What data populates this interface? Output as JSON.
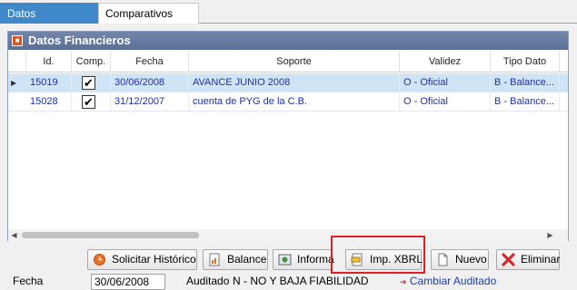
{
  "tabs": [
    {
      "label": "Datos Financieros",
      "active": true
    },
    {
      "label": "Comparativos",
      "active": false
    }
  ],
  "panel": {
    "title": "Datos Financieros",
    "columns": [
      "Id.",
      "Comp.",
      "Fecha",
      "Soporte",
      "Validez",
      "Tipo Dato"
    ],
    "rows": [
      {
        "id": "15019",
        "comp": true,
        "fecha": "30/06/2008",
        "soporte": "AVANCE JUNIO 2008",
        "validez": "O - Oficial",
        "tipo": "B - Balance...",
        "selected": true
      },
      {
        "id": "15028",
        "comp": true,
        "fecha": "31/12/2007",
        "soporte": "cuenta de PYG de la C.B.",
        "validez": "O - Oficial",
        "tipo": "B - Balance...",
        "selected": false
      }
    ]
  },
  "buttons": {
    "solicitar": "Solicitar Histórico",
    "balance": "Balance",
    "informa": "Informa",
    "imp_xbrl": "Imp. XBRL",
    "nuevo": "Nuevo",
    "eliminar": "Eliminar"
  },
  "footer": {
    "fecha_label": "Fecha",
    "fecha_value": "30/06/2008",
    "auditado_label": "Auditado",
    "auditado_value": "N - NO Y BAJA FIABILIDAD",
    "cambiar_link": "Cambiar Auditado"
  },
  "colors": {
    "accent": "#3f89cb",
    "header": "#5a6f96",
    "link": "#1e3cb4",
    "highlight": "#e02020"
  }
}
